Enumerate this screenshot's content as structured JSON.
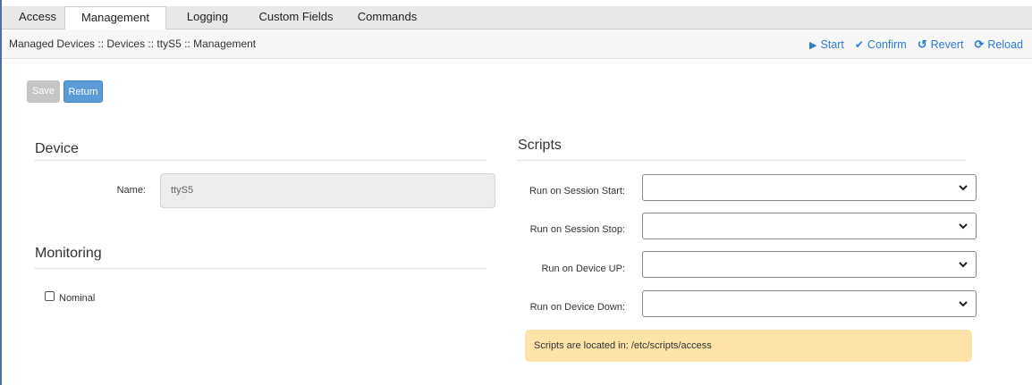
{
  "tabs": [
    "Access",
    "Management",
    "Logging",
    "Custom Fields",
    "Commands"
  ],
  "breadcrumb": "Managed Devices :: Devices :: ttyS5 :: Management",
  "actions": {
    "start": "Start",
    "confirm": "Confirm",
    "revert": "Revert",
    "reload": "Reload"
  },
  "buttons": {
    "save": "Save",
    "return": "Return"
  },
  "device": {
    "heading": "Device",
    "name_label": "Name:",
    "name_value": "ttyS5"
  },
  "monitoring": {
    "heading": "Monitoring",
    "nominal_label": "Nominal",
    "nominal_checked": false
  },
  "scripts": {
    "heading": "Scripts",
    "session_start_label": "Run on Session Start:",
    "session_stop_label": "Run on Session Stop:",
    "device_up_label": "Run on Device UP:",
    "device_down_label": "Run on Device Down:",
    "note": "Scripts are located in: /etc/scripts/access"
  },
  "colors": {
    "link": "#2f7bd3",
    "return_button": "#5b9bd8",
    "save_button": "#c5c5c5",
    "note_bg": "#fde3a8"
  }
}
